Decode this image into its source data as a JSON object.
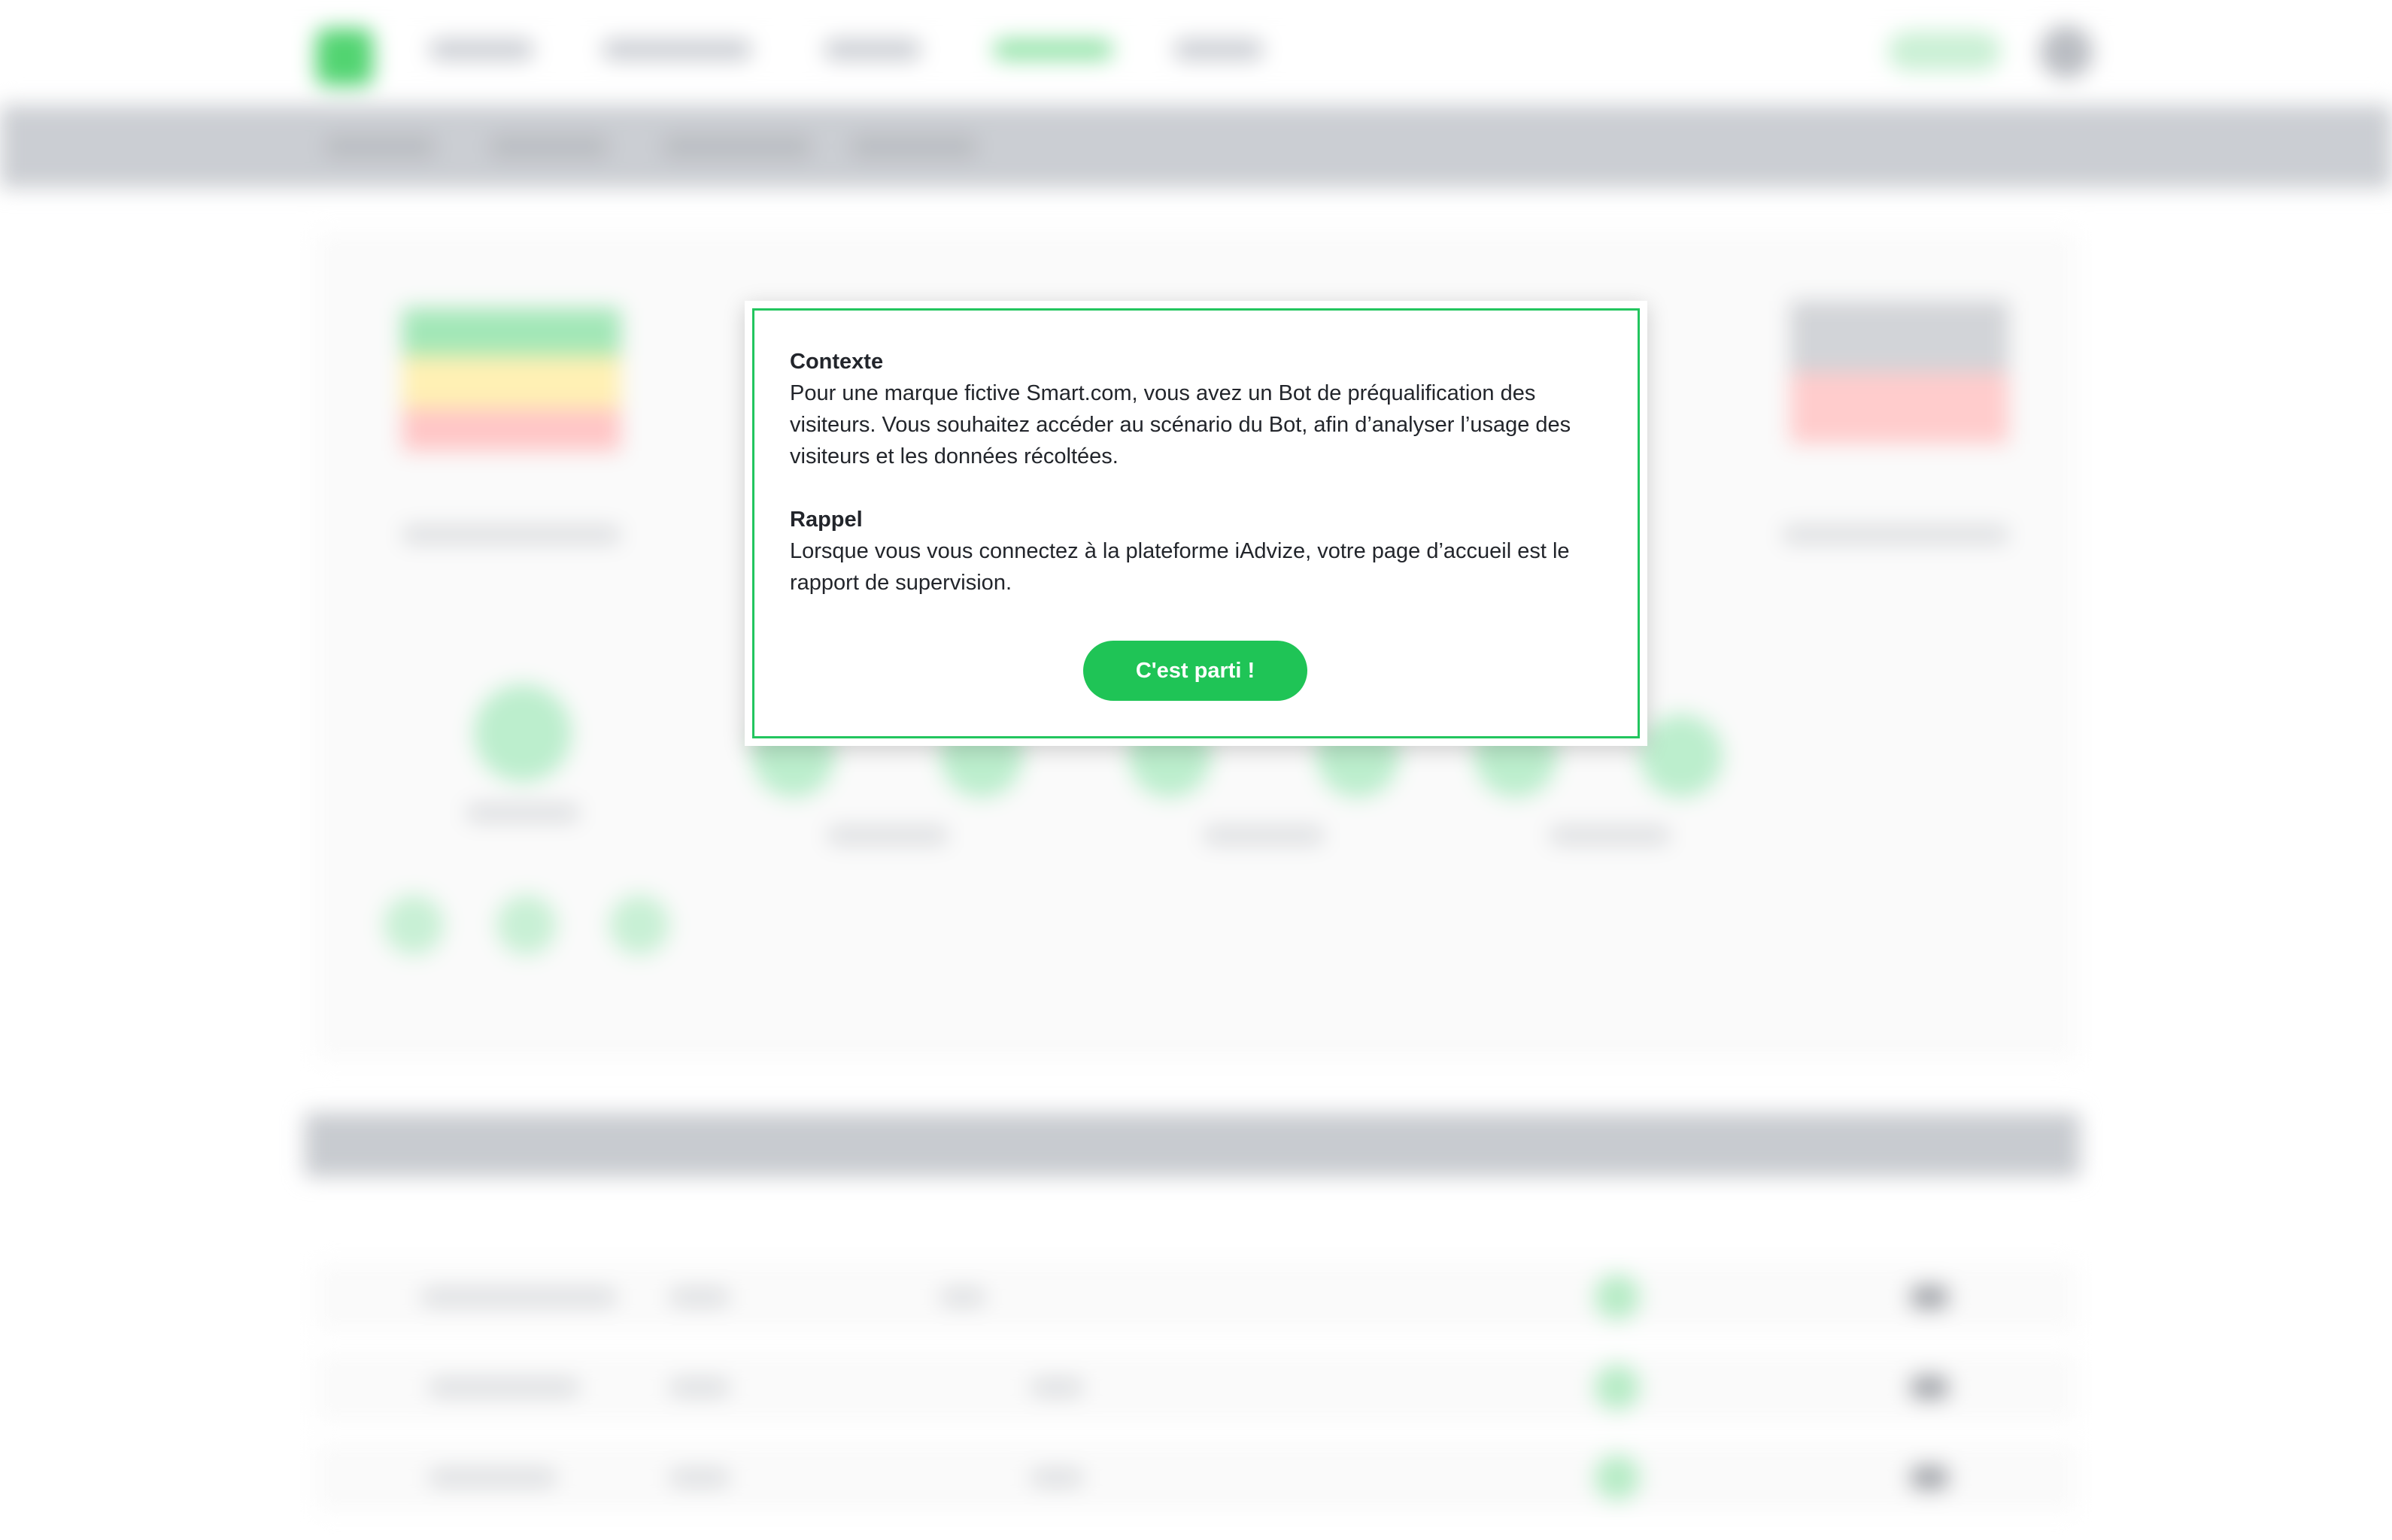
{
  "modal": {
    "context_title": "Contexte",
    "context_text": "Pour une marque fictive Smart.com, vous avez un Bot de préqualification des visiteurs. Vous souhaitez accéder au scénario du Bot, afin d’analyser l’usage des visiteurs et les données récoltées.",
    "reminder_title": "Rappel",
    "reminder_text": "Lorsque vous vous connectez à la plateforme iAdvize, votre page d’accueil est le rapport de supervision.",
    "cta_label": "C'est parti !"
  },
  "colors": {
    "accent": "#1fc456",
    "modal_border": "#22c55e",
    "text": "#22252b"
  }
}
